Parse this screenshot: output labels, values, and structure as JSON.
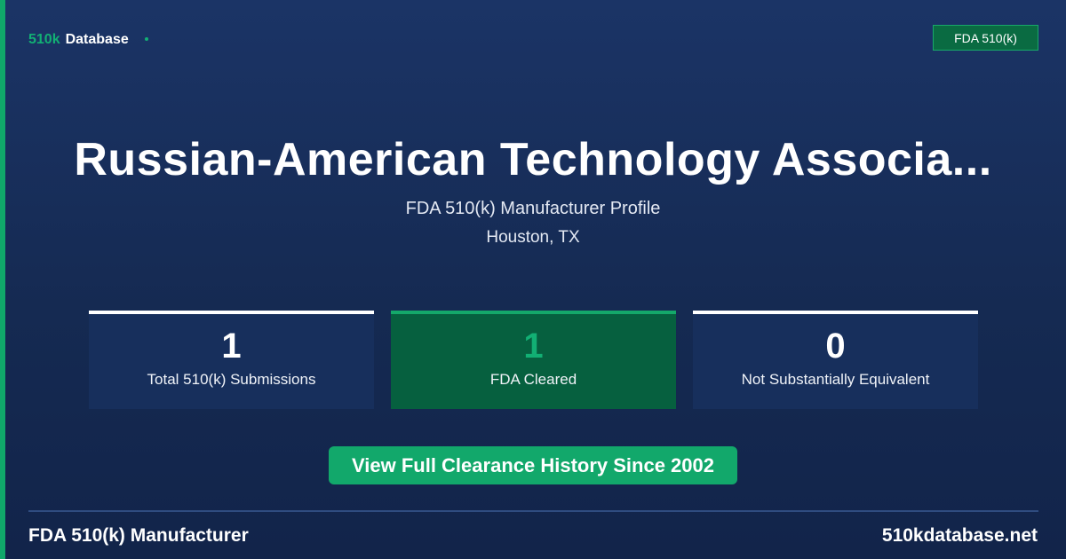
{
  "colors": {
    "background": "#1b3466",
    "accent_green": "#12b074",
    "cleared_card": "#06603f",
    "button": "#12a86b"
  },
  "brand": {
    "accent": "510k",
    "name": "Database"
  },
  "top_badge": "FDA 510(k)",
  "header": {
    "title": "Russian-American Technology Associa...",
    "subtitle": "FDA 510(k) Manufacturer Profile",
    "location": "Houston, TX"
  },
  "stats": [
    {
      "value": "1",
      "label": "Total 510(k) Submissions"
    },
    {
      "value": "1",
      "label": "FDA Cleared"
    },
    {
      "value": "0",
      "label": "Not Substantially Equivalent"
    }
  ],
  "cta": {
    "label": "View Full Clearance History Since 2002"
  },
  "footer": {
    "left": "FDA 510(k) Manufacturer",
    "right": "510kdatabase.net"
  }
}
